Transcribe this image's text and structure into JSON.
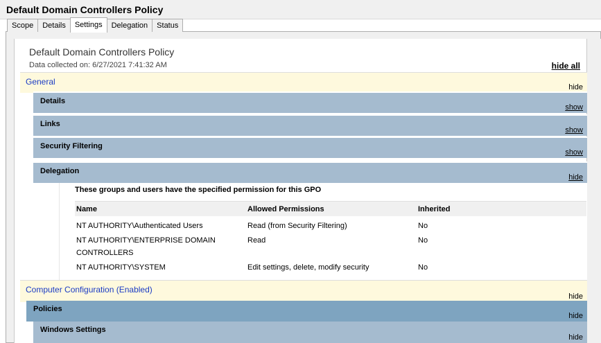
{
  "window": {
    "title": "Default Domain Controllers Policy"
  },
  "tabs": [
    {
      "label": "Scope",
      "active": false
    },
    {
      "label": "Details",
      "active": false
    },
    {
      "label": "Settings",
      "active": true
    },
    {
      "label": "Delegation",
      "active": false
    },
    {
      "label": "Status",
      "active": false
    }
  ],
  "report": {
    "title": "Default Domain Controllers Policy",
    "collected": "Data collected on: 6/27/2021 7:41:32 AM",
    "hide_all": "hide all"
  },
  "general": {
    "label": "General",
    "toggle": "hide",
    "sections": [
      {
        "label": "Details",
        "toggle": "show"
      },
      {
        "label": "Links",
        "toggle": "show"
      },
      {
        "label": "Security Filtering",
        "toggle": "show"
      },
      {
        "label": "Delegation",
        "toggle": "hide"
      }
    ]
  },
  "delegation": {
    "intro": "These groups and users have the specified permission for this GPO",
    "columns": [
      "Name",
      "Allowed Permissions",
      "Inherited"
    ],
    "rows": [
      {
        "name": "NT AUTHORITY\\Authenticated Users",
        "permissions": "Read (from Security Filtering)",
        "inherited": "No"
      },
      {
        "name": "NT AUTHORITY\\ENTERPRISE DOMAIN CONTROLLERS",
        "permissions": "Read",
        "inherited": "No"
      },
      {
        "name": "NT AUTHORITY\\SYSTEM",
        "permissions": "Edit settings, delete, modify security",
        "inherited": "No"
      }
    ]
  },
  "computer_config": {
    "label": "Computer Configuration (Enabled)",
    "toggle": "hide"
  },
  "policies": {
    "label": "Policies",
    "toggle": "hide"
  },
  "windows_settings": {
    "label": "Windows Settings",
    "toggle": "hide"
  },
  "colors": {
    "section_bg": "#fef9dd",
    "section_text": "#1a3bc4",
    "sub_band": "#a5bbcf",
    "policies_band": "#7ea4c0"
  }
}
